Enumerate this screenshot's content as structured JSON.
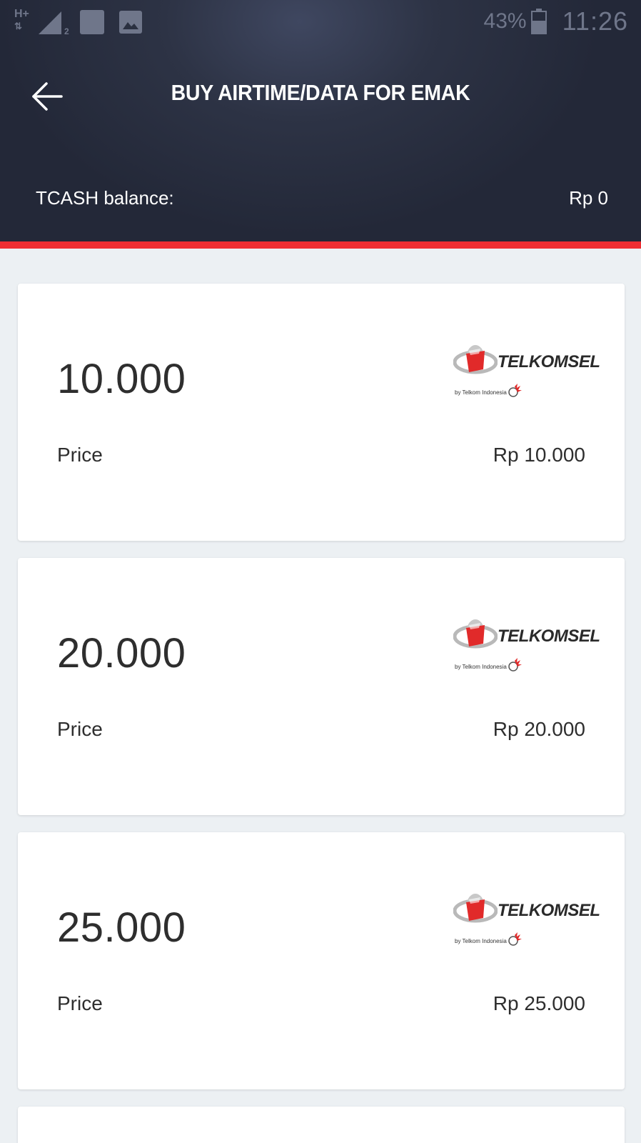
{
  "status_bar": {
    "network": "H+",
    "sim": "2",
    "battery": "43%",
    "time": "11:26"
  },
  "header": {
    "title": "BUY AIRTIME/DATA FOR EMAK",
    "back_icon": "arrow-left-icon",
    "balance_label": "TCASH balance:",
    "balance_value": "Rp 0"
  },
  "colors": {
    "header_bg": "#2a3040",
    "accent": "#ee2e33",
    "page_bg": "#ecf0f3",
    "card_bg": "#ffffff"
  },
  "products": [
    {
      "amount": "10.000",
      "price_label": "Price",
      "price": "Rp 10.000",
      "brand": "TELKOMSEL",
      "brand_sub": "by Telkom Indonesia"
    },
    {
      "amount": "20.000",
      "price_label": "Price",
      "price": "Rp 20.000",
      "brand": "TELKOMSEL",
      "brand_sub": "by Telkom Indonesia"
    },
    {
      "amount": "25.000",
      "price_label": "Price",
      "price": "Rp 25.000",
      "brand": "TELKOMSEL",
      "brand_sub": "by Telkom Indonesia"
    }
  ]
}
